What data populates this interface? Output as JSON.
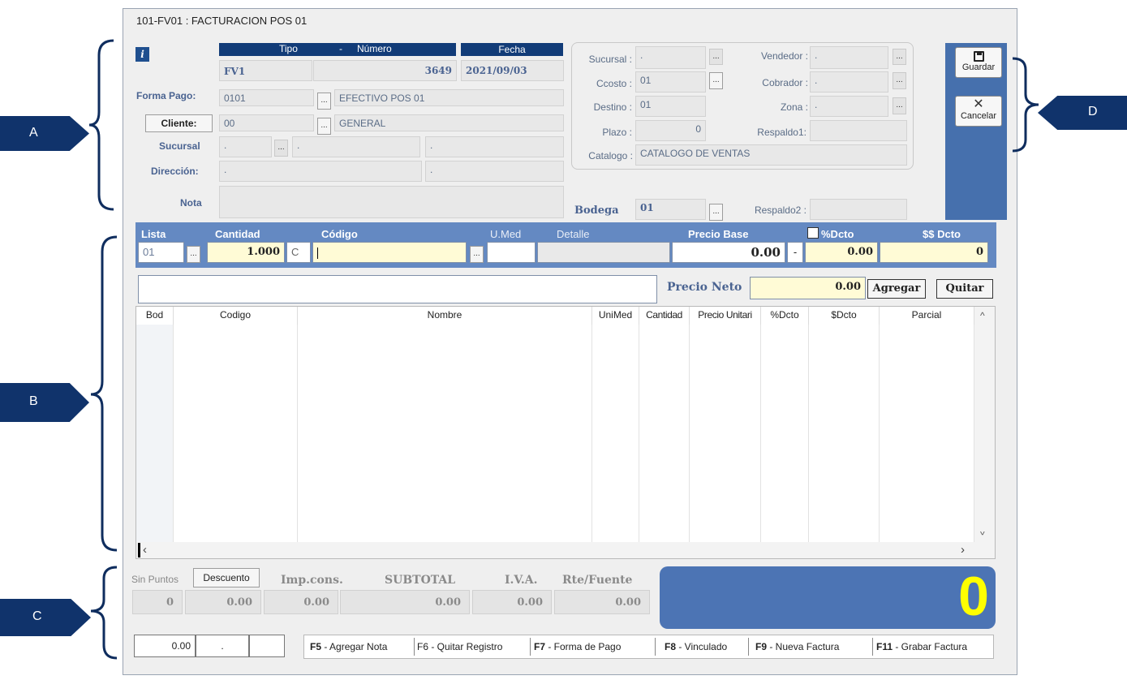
{
  "window": {
    "title": "101-FV01 : FACTURACION POS 01"
  },
  "header": {
    "tipo_label": "Tipo",
    "dash": "-",
    "numero_label": "Número",
    "fecha_label": "Fecha",
    "tipo": "FV1",
    "numero": "3649",
    "fecha": "2021/09/03",
    "info_icon": "i"
  },
  "left": {
    "forma_pago_label": "Forma Pago:",
    "forma_pago_code": "0101",
    "forma_pago_name": "EFECTIVO POS 01",
    "cliente_button": "Cliente:",
    "cliente_code": "00",
    "cliente_name": "GENERAL",
    "sucursal_label": "Sucursal",
    "sucursal_1": ".",
    "sucursal_2": ".",
    "sucursal_3": ".",
    "direccion_label": "Dirección:",
    "direccion_1": ".",
    "direccion_2": ".",
    "nota_label": "Nota",
    "nota_value": ""
  },
  "right": {
    "sucursal_label": "Sucursal :",
    "sucursal_value": ".",
    "ccosto_label": "Ccosto :",
    "ccosto_value": "01",
    "destino_label": "Destino :",
    "destino_value": "01",
    "plazo_label": "Plazo :",
    "plazo_value": "0",
    "catalogo_label": "Catalogo :",
    "catalogo_value": "CATALOGO DE VENTAS",
    "vendedor_label": "Vendedor :",
    "vendedor_value": ".",
    "cobrador_label": "Cobrador :",
    "cobrador_value": ".",
    "zona_label": "Zona :",
    "zona_value": ".",
    "respaldo1_label": "Respaldo1:",
    "respaldo1_value": "",
    "bodega_label": "Bodega",
    "bodega_value": "01",
    "respaldo2_label": "Respaldo2 :",
    "respaldo2_value": ""
  },
  "toolbar": {
    "guardar": "Guardar",
    "cancelar": "Cancelar"
  },
  "entry": {
    "lista_label": "Lista",
    "cantidad_label": "Cantidad",
    "codigo_label": "Código",
    "umed_label": "U.Med",
    "detalle_label": "Detalle",
    "precio_base_label": "Precio Base",
    "pct_dcto_label": "%Dcto",
    "dollar_dcto_label": "$$ Dcto",
    "lista_value": "01",
    "cantidad_value": "1.000",
    "c_value": "C",
    "codigo_value": "",
    "umed_value": "",
    "detalle_value": "",
    "precio_base_value": "0.00",
    "minus": "-",
    "pct_dcto_value": "0.00",
    "dollar_dcto_value": "0",
    "description_value": "",
    "precio_neto_label": "Precio Neto",
    "precio_neto_value": "0.00",
    "agregar": "Agregar",
    "quitar": "Quitar"
  },
  "grid": {
    "columns": [
      "Bod",
      "Codigo",
      "Nombre",
      "UniMed",
      "Cantidad",
      "Precio Unitari",
      "%Dcto",
      "$Dcto",
      "Parcial"
    ],
    "rows": []
  },
  "totals": {
    "sin_puntos": "Sin Puntos",
    "descuento": "Descuento",
    "imp_cons": "Imp.cons.",
    "subtotal": "SUBTOTAL",
    "iva": "I.V.A.",
    "rte_fuente": "Rte/Fuente",
    "sin_puntos_value": "0",
    "descuento_value": "0.00",
    "imp_cons_value": "0.00",
    "subtotal_value": "0.00",
    "iva_value": "0.00",
    "rte_fuente_value": "0.00",
    "grand_total": "0"
  },
  "footer": {
    "amount": "0.00",
    "dot": ".",
    "f5_key": "F5",
    "f5_text": " - Agregar  Nota",
    "f6_text": "F6 - Quitar  Registro",
    "f7_key": "F7",
    "f7_text": "  -  Forma de Pago",
    "f8_key": "F8",
    "f8_text": " - Vinculado",
    "f9_key": "F9",
    "f9_text": " - Nueva Factura",
    "f11_key": "F11",
    "f11_text": " - Grabar Factura"
  },
  "annotations": {
    "a": "A",
    "b": "B",
    "c": "C",
    "d": "D"
  },
  "colors": {
    "header_blue": "#123c78",
    "strip_blue": "#6489c2",
    "total_blue": "#4c74b4",
    "total_yellow": "#ffff00",
    "callout_navy": "#10336b"
  }
}
